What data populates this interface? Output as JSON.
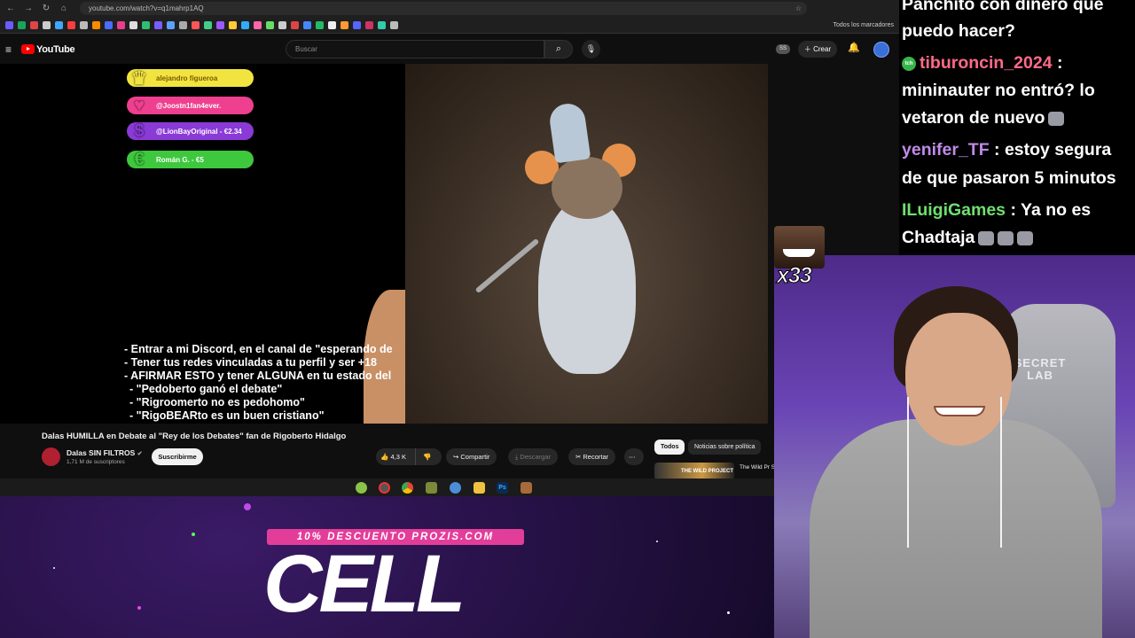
{
  "browser": {
    "url": "youtube.com/watch?v=q1mahrp1AQ",
    "bookmarks_folder": "Todos los marcadores"
  },
  "youtube": {
    "logo": "YouTube",
    "search_placeholder": "Buscar",
    "badge": "SS",
    "create_label": "Crear"
  },
  "overlay": {
    "donors": [
      {
        "label": "alejandro figueroa",
        "color": "#f2e440",
        "icon": "crown-icon"
      },
      {
        "label": "@Joostn1fan4ever.",
        "color": "#ef3f8f",
        "icon": "heart-icon"
      },
      {
        "label": "@LionBayOriginal - €2.34",
        "color": "#8a3ad6",
        "icon": "dollar-icon"
      },
      {
        "label": "Román G. - €5",
        "color": "#3ec83e",
        "icon": "coins-icon"
      }
    ],
    "rules": [
      "- Entrar a mi Discord, en el canal de \"esperando de",
      "- Tener tus redes vinculadas a tu perfil y ser +18",
      "- AFIRMAR ESTO y tener ALGUNA en tu estado del",
      "\"Pedoberto ganó el debate\"",
      "\"Rigroomerto no es pedohomo\"",
      "\"RigoBEARto es un buen cristiano\""
    ]
  },
  "video": {
    "title": "Dalas HUMILLA en Debate al \"Rey de los Debates\" fan de Rigoberto Hidalgo",
    "channel": "Dalas SIN FILTROS",
    "subscribers": "1,71 M de suscriptores",
    "subscribe_label": "Suscribirme",
    "likes": "4,3 K",
    "share_label": "Compartir",
    "download_label": "Descargar",
    "clip_label": "Recortar",
    "more_label": "⋯"
  },
  "related": {
    "chips": [
      "Todos",
      "Noticias sobre política"
    ],
    "first_title": "The Wild Pr Santaolalla",
    "thumb_text": "THE WILD PROJECT"
  },
  "chat": {
    "messages": [
      {
        "user": "",
        "user_color": "#ffffff",
        "text": "Panchito con dinero que"
      },
      {
        "user": "",
        "user_color": "#ffffff",
        "text": "puedo hacer?"
      },
      {
        "user": "tiburoncin_2024",
        "user_color": "#ff6a88",
        "text": " :",
        "badge": "tch"
      },
      {
        "user": "",
        "user_color": "#ffffff",
        "text": "mininauter no entró? lo"
      },
      {
        "user": "",
        "user_color": "#ffffff",
        "text": "vetaron de nuevo"
      },
      {
        "user": "yenifer_TF",
        "user_color": "#c08ae8",
        "text": " : estoy segura"
      },
      {
        "user": "",
        "user_color": "#ffffff",
        "text": "de que pasaron 5 minutos"
      },
      {
        "user": "ILuigiGames",
        "user_color": "#6fe06f",
        "text": " : Ya no es"
      },
      {
        "user": "",
        "user_color": "#ffffff",
        "text": "Chadtaja"
      }
    ]
  },
  "stream": {
    "emote_count": "x33",
    "chair_brand": "SECRET LAB",
    "promo_code": "10% DESCUENTO PROZIS.COM",
    "promo_big": "CELL"
  },
  "colors": {
    "yt_red": "#ff0000",
    "promo_pink": "#e33d9a"
  }
}
